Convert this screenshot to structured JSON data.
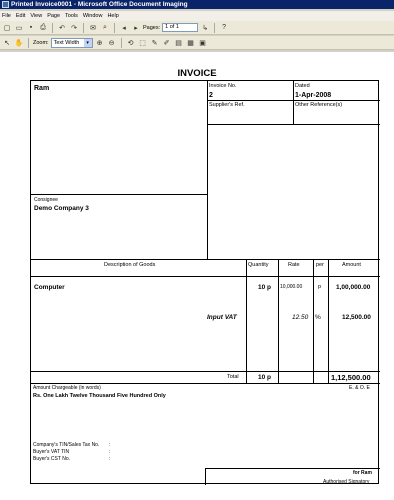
{
  "window": {
    "title": "Printed Invoice0001 - Microsoft Office Document Imaging"
  },
  "menu": [
    "File",
    "Edit",
    "View",
    "Page",
    "Tools",
    "Window",
    "Help"
  ],
  "toolbar": {
    "pages_label": "Pages:",
    "pages_value": "1 of 1",
    "zoom_label": "Zoom:",
    "zoom_value": "Text Width"
  },
  "invoice": {
    "heading": "INVOICE",
    "seller": "Ram",
    "invoice_no_label": "Invoice No.",
    "invoice_no": "2",
    "dated_label": "Dated",
    "dated": "1-Apr-2008",
    "suppliers_ref_label": "Supplier's Ref.",
    "other_ref_label": "Other Reference(s)",
    "consignee_label": "Consignee",
    "consignee": "Demo Company 3",
    "columns": {
      "description": "Description of Goods",
      "quantity": "Quantity",
      "rate": "Rate",
      "per": "per",
      "amount": "Amount"
    },
    "item": {
      "description": "Computer",
      "quantity": "10 p",
      "rate": "10,000.00",
      "per": "p",
      "amount": "1,00,000.00"
    },
    "tax": {
      "description": "Input VAT",
      "rate": "12.50",
      "per": "%",
      "amount": "12,500.00"
    },
    "total_label": "Total",
    "total_quantity": "10 p",
    "total_amount": "1,12,500.00",
    "amount_words_label": "Amount Chargeable (in words)",
    "eoe": "E. & O. E",
    "amount_words": "Rs. One Lakh Twelve Thousand Five Hundred Only",
    "company_tin_label": "Company's TIN/Sales Tax No.",
    "buyer_vat_label": "Buyer's VAT TIN",
    "buyer_cst_label": "Buyer's CST No.",
    "colon": ":",
    "for_company": "for Ram",
    "signatory": "Authorised Signatory"
  }
}
